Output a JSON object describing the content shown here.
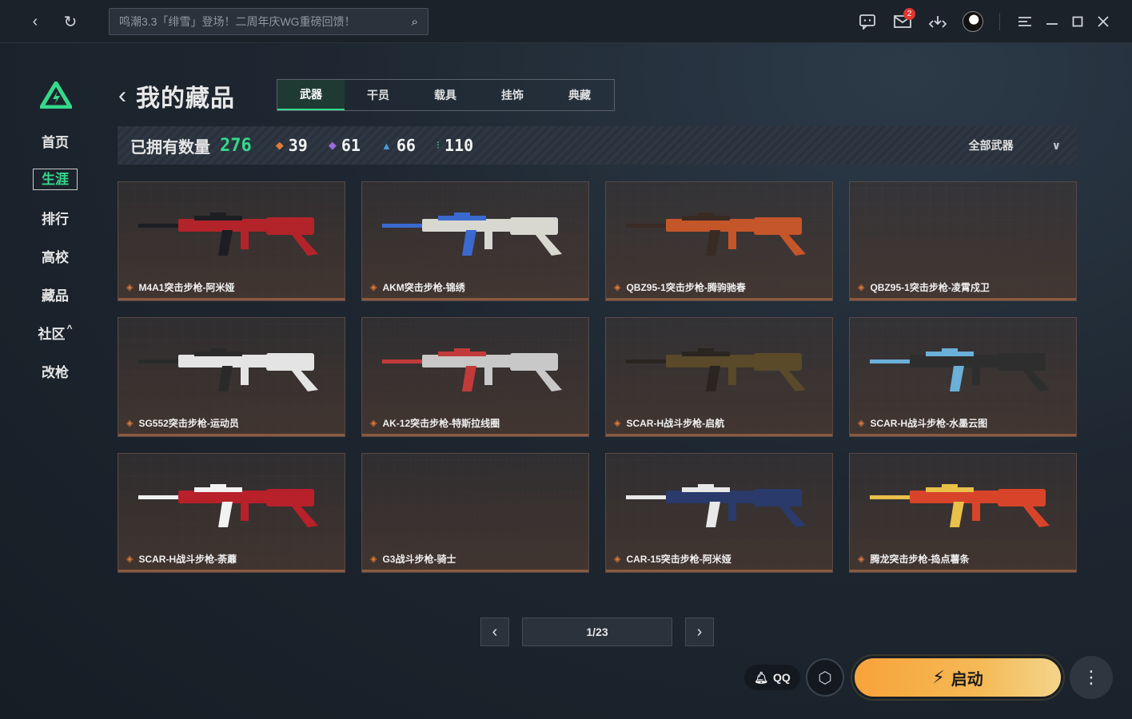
{
  "topbar": {
    "search_placeholder": "鸣潮3.3「绯雪」登场！二周年庆WG重磅回馈！",
    "mail_badge": "2",
    "icons": [
      "back-icon",
      "refresh-icon",
      "search-icon",
      "chat-icon",
      "mail-icon",
      "download-icon",
      "avatar",
      "menu-icon",
      "minimize-icon",
      "maximize-icon",
      "close-icon"
    ]
  },
  "sidebar": {
    "items": [
      {
        "label": "首页"
      },
      {
        "label": "生涯",
        "active": true
      },
      {
        "label": "排行"
      },
      {
        "label": "高校"
      },
      {
        "label": "藏品"
      },
      {
        "label": "社区",
        "suffix": "^"
      },
      {
        "label": "改枪"
      }
    ]
  },
  "main": {
    "title": "我的藏品",
    "tabs": [
      {
        "label": "武器",
        "active": true
      },
      {
        "label": "干员"
      },
      {
        "label": "载具"
      },
      {
        "label": "挂饰"
      },
      {
        "label": "典藏"
      }
    ],
    "stats": {
      "label": "已拥有数量",
      "total": "276",
      "items": [
        {
          "value": "39",
          "gem_color": "#e07a3a"
        },
        {
          "value": "61",
          "gem_color": "#9a6ad8"
        },
        {
          "value": "66",
          "gem_color": "#4a9ad8"
        },
        {
          "value": "110",
          "gem_color": "#35d98c"
        }
      ],
      "filter": "全部武器"
    },
    "weapons": [
      {
        "name": "M4A1突击步枪-阿米娅",
        "color": "#b3242a",
        "accent": "#1d1d24"
      },
      {
        "name": "AKM突击步枪-锦绣",
        "color": "#d8d8d0",
        "accent": "#3a6ad0"
      },
      {
        "name": "QBZ95-1突击步枪-腾驹驰春",
        "color": "#c4562a",
        "accent": "#3a2a24"
      },
      {
        "name": "QBZ95-1突击步枪-凌霄戍卫",
        "color": "",
        "accent": ""
      },
      {
        "name": "SG552突击步枪-运动员",
        "color": "#e4e4e4",
        "accent": "#2a2a2a"
      },
      {
        "name": "AK-12突击步枪-特斯拉线圈",
        "color": "#c8c8c8",
        "accent": "#c23a3a"
      },
      {
        "name": "SCAR-H战斗步枪-启航",
        "color": "#5a4a2a",
        "accent": "#2a2520"
      },
      {
        "name": "SCAR-H战斗步枪-水墨云图",
        "color": "#2e2e2e",
        "accent": "#6ab0d8"
      },
      {
        "name": "SCAR-H战斗步枪-荼蘼",
        "color": "#b8202a",
        "accent": "#f2f2f2"
      },
      {
        "name": "G3战斗步枪-骑士",
        "color": "",
        "accent": ""
      },
      {
        "name": "CAR-15突击步枪-阿米娅",
        "color": "#2a3a6a",
        "accent": "#e8e8e8"
      },
      {
        "name": "腾龙突击步枪-捣点薯条",
        "color": "#d8442a",
        "accent": "#e8c04a"
      }
    ],
    "pager": {
      "text": "1/23",
      "prev": "‹",
      "next": "›"
    }
  },
  "footer": {
    "qq": "QQ",
    "launch": "启动"
  }
}
